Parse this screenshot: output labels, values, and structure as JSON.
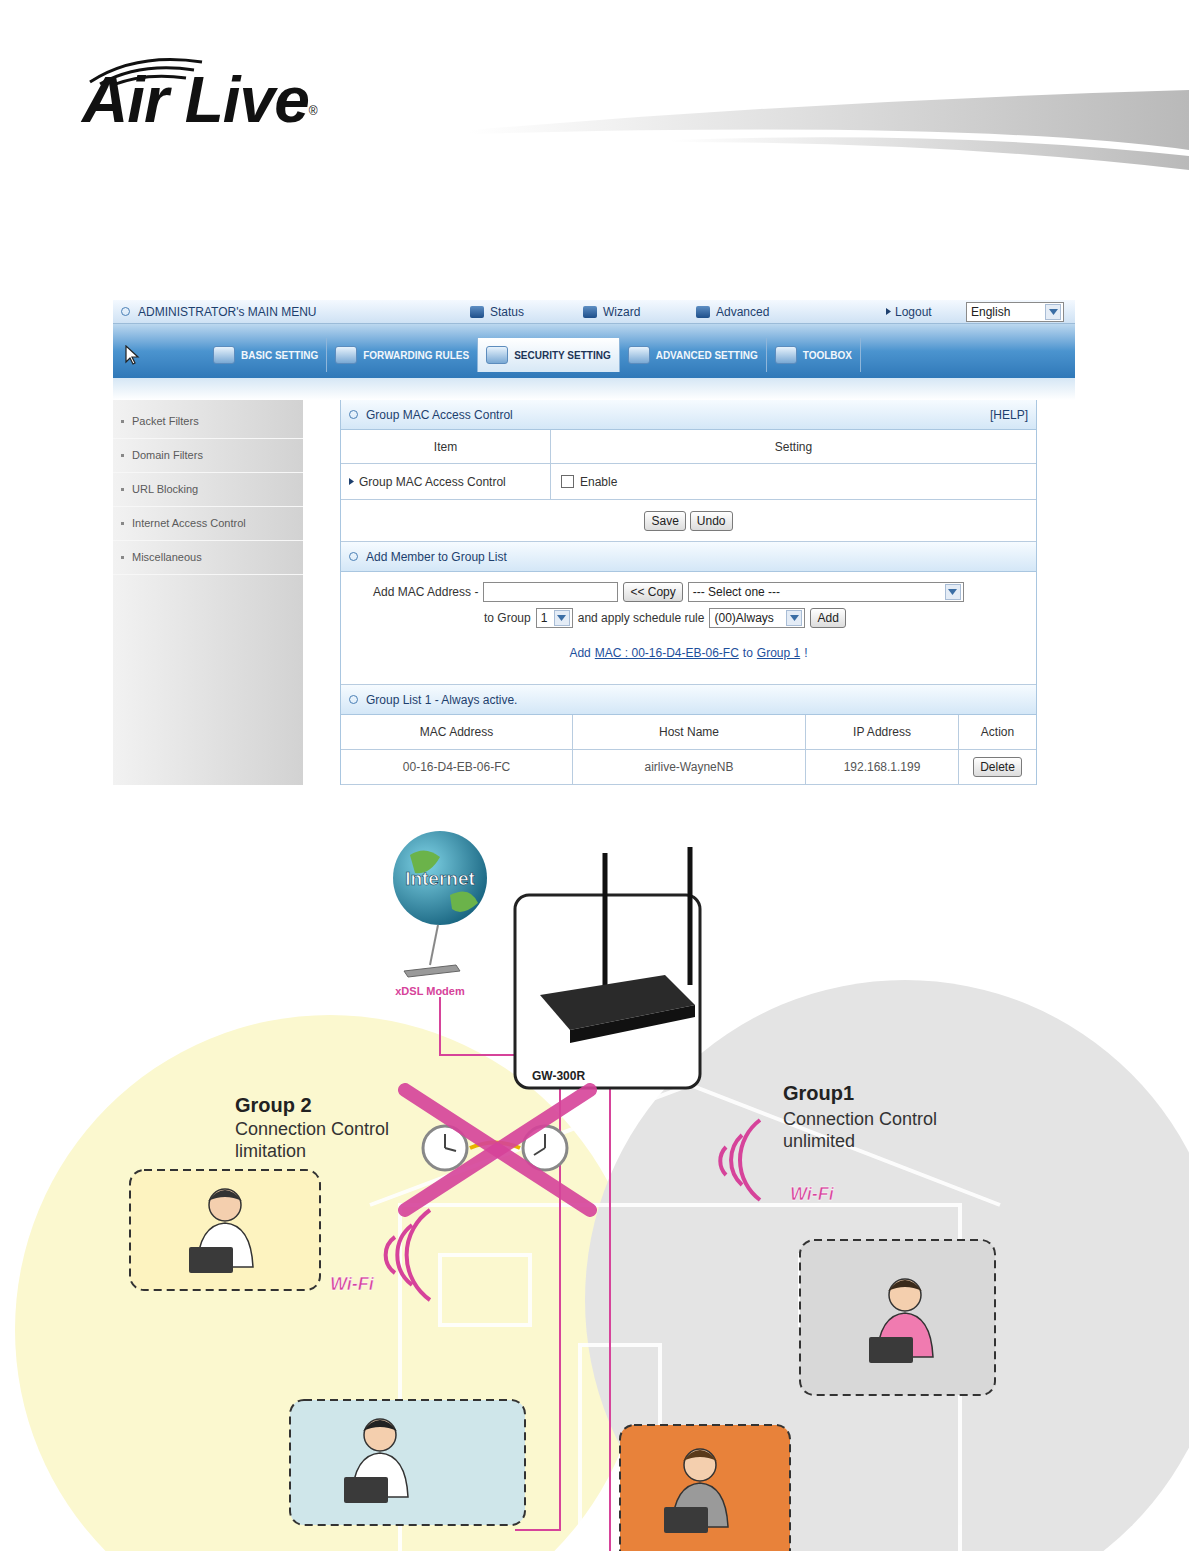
{
  "logo": {
    "text": "Air Live",
    "mark": "®"
  },
  "top_menu": {
    "title": "ADMINISTRATOR's MAIN MENU",
    "items": [
      "Status",
      "Wizard",
      "Advanced"
    ],
    "logout": "Logout",
    "language": "English"
  },
  "tabs": [
    {
      "label": "BASIC SETTING",
      "selected": false
    },
    {
      "label": "FORWARDING RULES",
      "selected": false
    },
    {
      "label": "SECURITY SETTING",
      "selected": true
    },
    {
      "label": "ADVANCED SETTING",
      "selected": false
    },
    {
      "label": "TOOLBOX",
      "selected": false
    }
  ],
  "sidebar": {
    "items": [
      "Packet Filters",
      "Domain Filters",
      "URL Blocking",
      "Internet Access Control",
      "Miscellaneous"
    ]
  },
  "access_panel": {
    "title": "Group MAC Access Control",
    "help": "[HELP]",
    "columns": [
      "Item",
      "Setting"
    ],
    "row_label": "Group MAC Access Control",
    "checkbox": {
      "label": "Enable",
      "checked": false
    },
    "buttons": [
      "Save",
      "Undo"
    ]
  },
  "add_member": {
    "title": "Add Member to Group List",
    "mac_label": "Add MAC Address -",
    "mac_value": "",
    "copy_button": "<< Copy",
    "host_select": "--- Select one ---",
    "group_label": "to Group",
    "group": "1",
    "schedule_label": "and apply schedule rule",
    "schedule": "(00)Always",
    "add_button": "Add",
    "hint": {
      "prefix": "Add",
      "mac_link": "MAC : 00-16-D4-EB-06-FC",
      "middle": "to",
      "group_link": "Group 1",
      "suffix": "!"
    }
  },
  "group_list": {
    "title": "Group List 1 - Always active.",
    "columns": [
      "MAC Address",
      "Host Name",
      "IP Address",
      "Action"
    ],
    "rows": [
      {
        "mac": "00-16-D4-EB-06-FC",
        "host": "airlive-WayneNB",
        "ip": "192.168.1.199",
        "action": "Delete"
      }
    ]
  },
  "diagram": {
    "internet": "Internet",
    "modem": "xDSL Modem",
    "router": "GW-300R",
    "wifi_labels": [
      "Wi-Fi",
      "Wi-Fi"
    ],
    "groups": [
      {
        "name": "Group 2",
        "lines": [
          "Connection Control",
          "limitation"
        ],
        "color": "#fbf8cf"
      },
      {
        "name": "Group1",
        "lines": [
          "Connection Control",
          "unlimited"
        ],
        "color": "#e4e4e4"
      }
    ]
  }
}
